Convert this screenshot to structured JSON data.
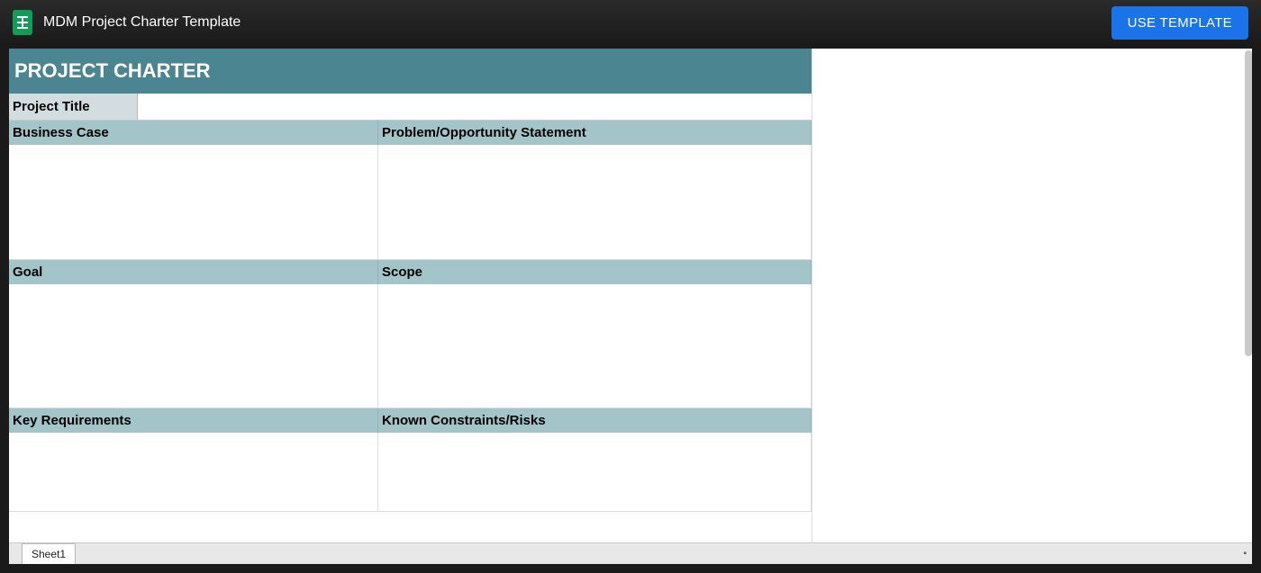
{
  "topbar": {
    "doc_title": "MDM Project Charter Template",
    "use_template_label": "USE TEMPLATE"
  },
  "charter": {
    "main_heading": "PROJECT CHARTER",
    "project_title_label": "Project Title",
    "project_title_value": "",
    "sections": [
      {
        "left_label": "Business Case",
        "right_label": "Problem/Opportunity Statement",
        "left_value": "",
        "right_value": ""
      },
      {
        "left_label": "Goal",
        "right_label": "Scope",
        "left_value": "",
        "right_value": ""
      },
      {
        "left_label": "Key Requirements",
        "right_label": "Known Constraints/Risks",
        "left_value": "",
        "right_value": ""
      }
    ]
  },
  "tabs": {
    "sheet1": "Sheet1"
  }
}
